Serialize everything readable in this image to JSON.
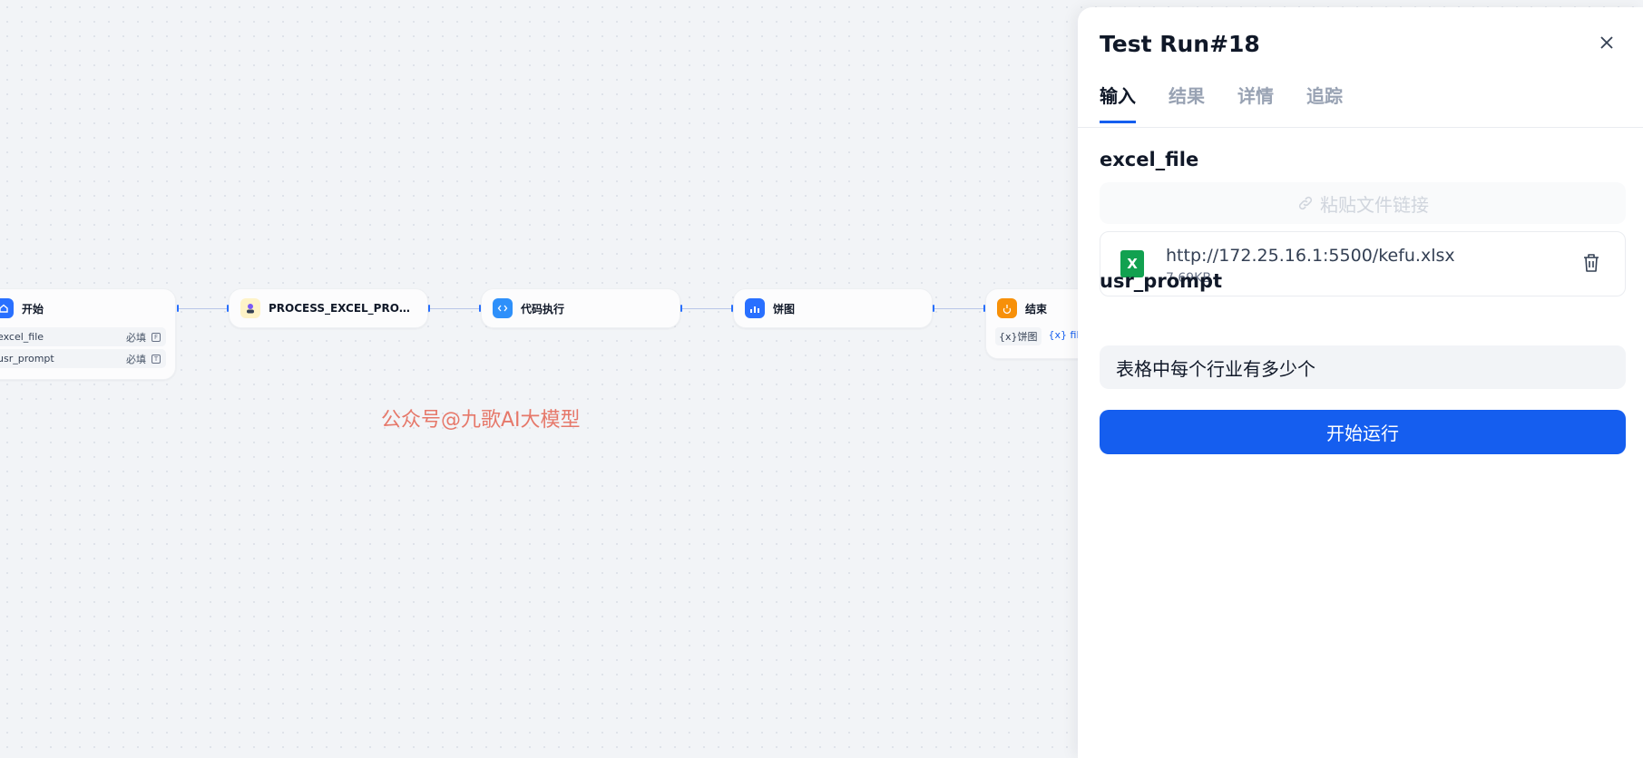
{
  "workflow": {
    "nodes": [
      {
        "title": "开始",
        "icon": "home-icon",
        "color": "#2970ff",
        "vars": [
          {
            "name": "excel_file",
            "required": "必填"
          },
          {
            "name": "usr_prompt",
            "required": "必填"
          }
        ]
      },
      {
        "title": "PROCESS_EXCEL_PROCESS_EXCEL",
        "icon": "agent-avatar-icon",
        "color": "#fef3c7"
      },
      {
        "title": "代码执行",
        "icon": "code-icon",
        "color": "#2e90fa"
      },
      {
        "title": "饼图",
        "icon": "chart-icon",
        "color": "#2970ff"
      },
      {
        "title": "结束",
        "icon": "end-icon",
        "color": "#f79009",
        "outputs": [
          {
            "prefix": "{x}",
            "text": "饼图"
          },
          {
            "prefix": "{x}",
            "text": "files"
          }
        ]
      }
    ],
    "watermark": "公众号@九歌AI大模型"
  },
  "panel": {
    "title": "Test Run#18",
    "close_icon": "close-icon",
    "tabs": [
      {
        "label": "输入",
        "active": true
      },
      {
        "label": "结果",
        "active": false
      },
      {
        "label": "详情",
        "active": false
      },
      {
        "label": "追踪",
        "active": false
      }
    ],
    "excel_file": {
      "label": "excel_file",
      "paste_placeholder": "粘贴文件链接",
      "file": {
        "url": "http://172.25.16.1:5500/kefu.xlsx",
        "size": "7.69KB",
        "type_icon": "X"
      }
    },
    "usr_prompt": {
      "label": "usr_prompt",
      "value": "表格中每个行业有多少个"
    },
    "run_button": "开始运行",
    "accent_color": "#155eef"
  }
}
